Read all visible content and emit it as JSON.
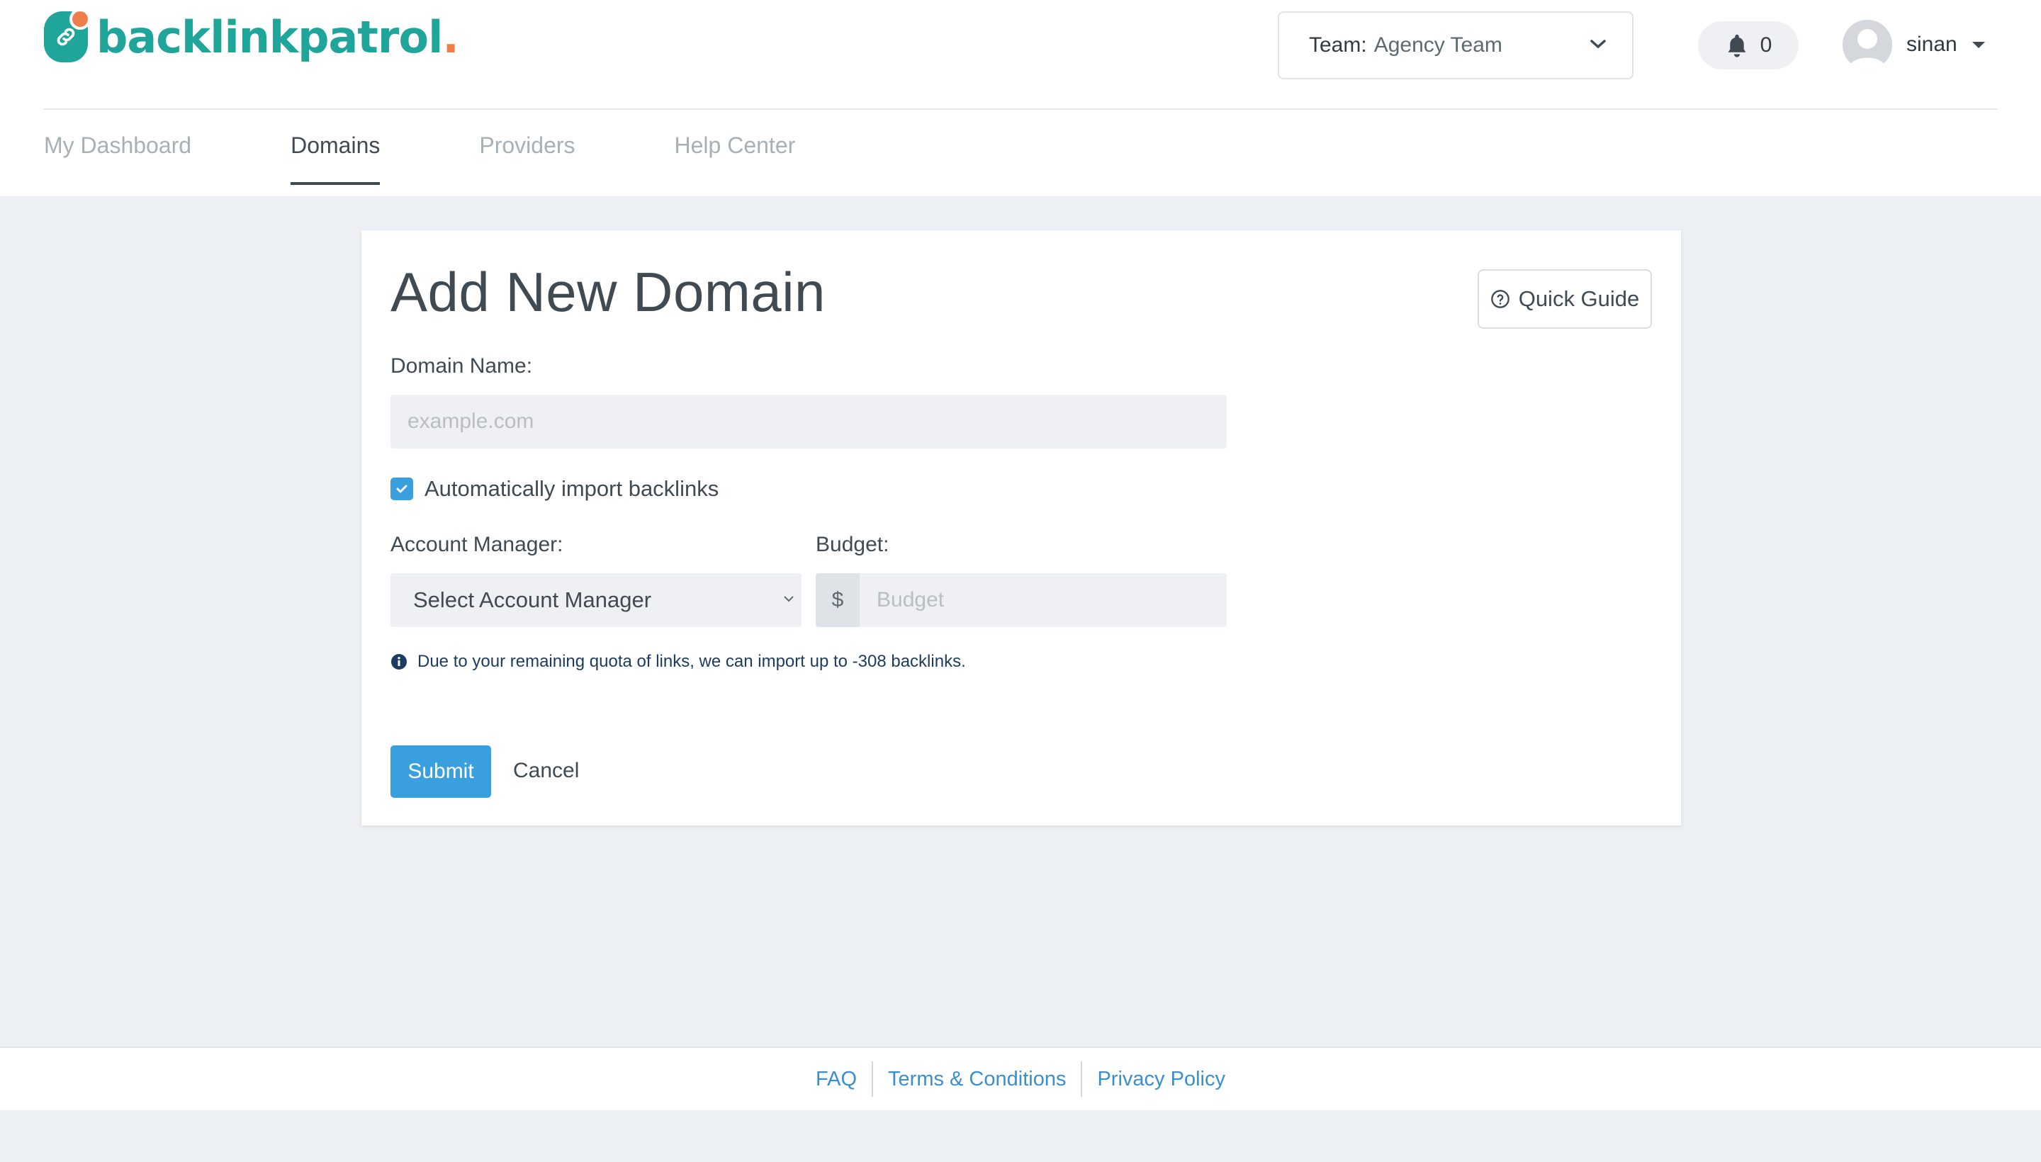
{
  "brand": {
    "name": "backlinkpatrol",
    "dot": ".",
    "color": "#1fa59a",
    "accent": "#f07e4b"
  },
  "header": {
    "team_label": "Team:",
    "team_value": "Agency Team",
    "notifications_count": "0",
    "username": "sinan"
  },
  "nav": {
    "items": [
      {
        "label": "My Dashboard"
      },
      {
        "label": "Domains"
      },
      {
        "label": "Providers"
      },
      {
        "label": "Help Center"
      }
    ],
    "active": "Domains"
  },
  "form": {
    "title": "Add New Domain",
    "quick_guide_label": "Quick Guide",
    "domain_label": "Domain Name:",
    "domain_placeholder": "example.com",
    "auto_import_label": "Automatically import backlinks",
    "auto_import_checked": true,
    "account_manager_label": "Account Manager:",
    "account_manager_value": "Select Account Manager",
    "budget_label": "Budget:",
    "budget_prefix": "$",
    "budget_placeholder": "Budget",
    "info_text": "Due to your remaining quota of links, we can import up to -308 backlinks.",
    "submit_label": "Submit",
    "cancel_label": "Cancel"
  },
  "footer": {
    "links": [
      {
        "label": "FAQ"
      },
      {
        "label": "Terms & Conditions"
      },
      {
        "label": "Privacy Policy"
      }
    ]
  },
  "colors": {
    "primary": "#3aa0dd",
    "link": "#3a8fcf",
    "background": "#eceff3"
  }
}
